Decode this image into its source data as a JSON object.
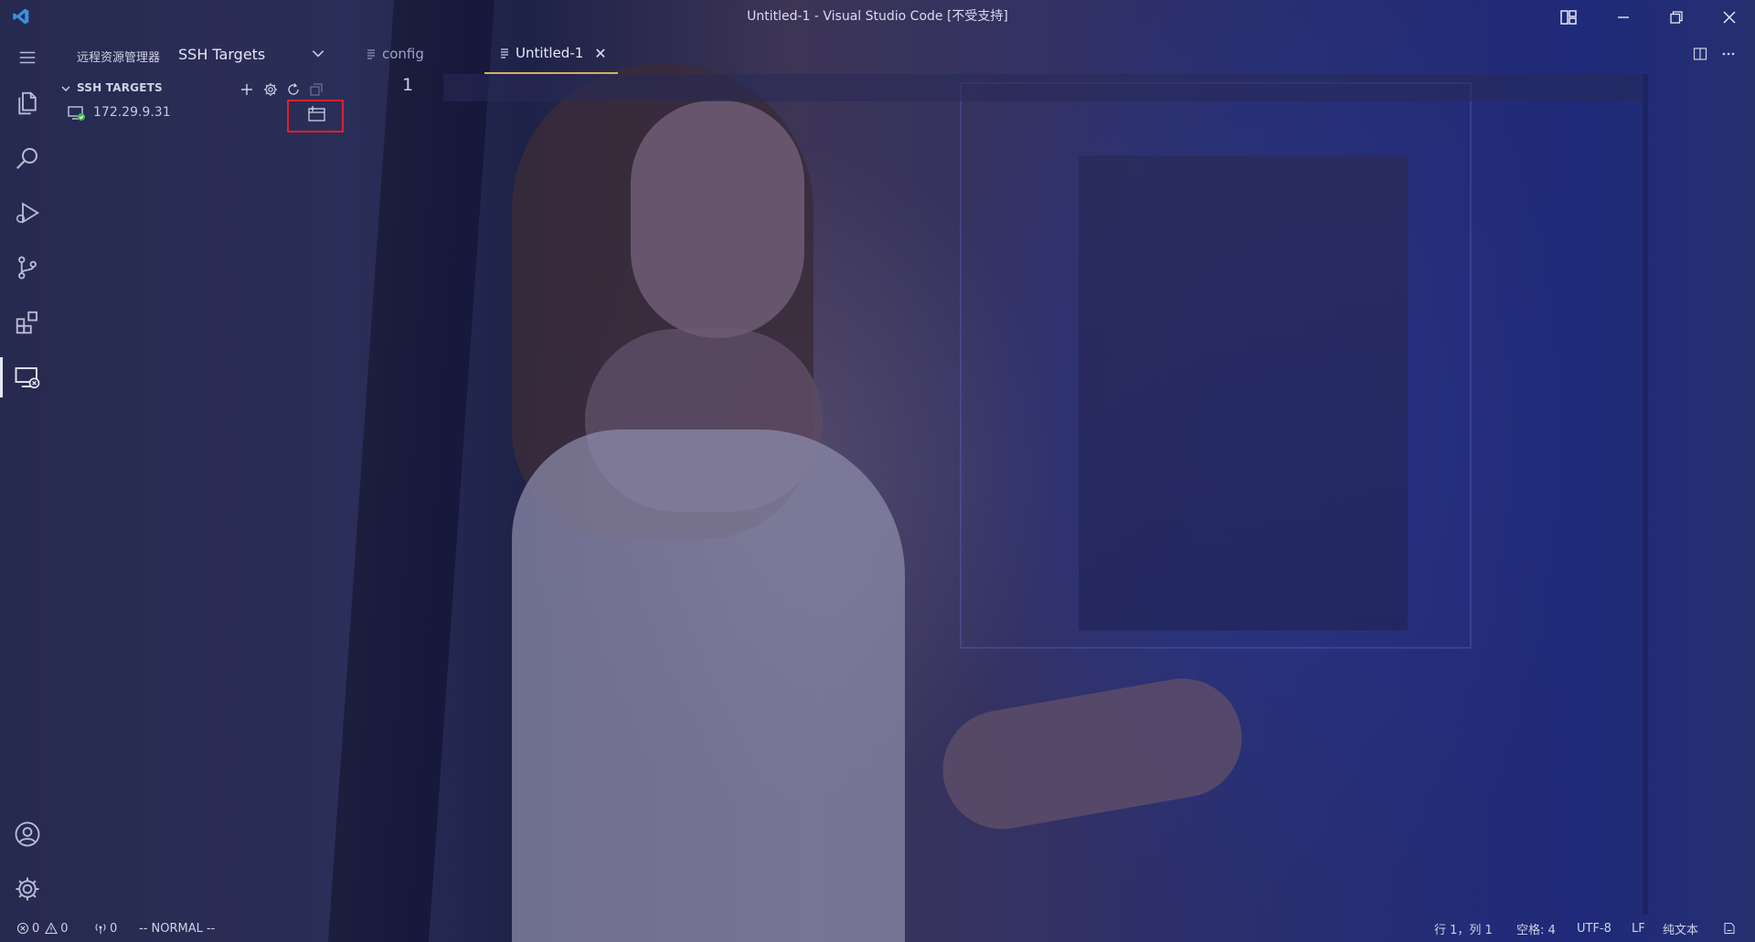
{
  "window": {
    "title": "Untitled-1 - Visual Studio Code [不受支持]",
    "controls": [
      "layout-icon",
      "minimize-icon",
      "restore-icon",
      "close-icon"
    ]
  },
  "activity_bar": {
    "items": [
      "menu-icon",
      "explorer-icon",
      "search-icon",
      "run-debug-icon",
      "source-control-icon",
      "extensions-icon",
      "remote-explorer-icon"
    ],
    "bottom": [
      "accounts-icon",
      "manage-gear-icon"
    ],
    "active": "remote-explorer-icon"
  },
  "sidebar": {
    "header_label": "远程资源管理器",
    "selector_value": "SSH Targets",
    "section_title": "SSH TARGETS",
    "section_actions": [
      "add-icon",
      "settings-gear-icon",
      "refresh-icon",
      "collapse-all-icon"
    ],
    "hosts": [
      {
        "label": "172.29.9.31",
        "action": "open-in-new-window-icon"
      }
    ]
  },
  "editor": {
    "tabs": [
      {
        "label": "config",
        "active": false
      },
      {
        "label": "Untitled-1",
        "active": true,
        "close": "✕"
      }
    ],
    "line_number": "1",
    "actions": [
      "split-editor-icon",
      "more-actions-icon"
    ]
  },
  "status_bar": {
    "errors": "0",
    "warnings": "0",
    "ports": "0",
    "vim_mode": "-- NORMAL --",
    "position": "行 1，列 1",
    "indent": "空格: 4",
    "encoding": "UTF-8",
    "eol": "LF",
    "language": "纯文本"
  },
  "colors": {
    "accent_tab": "#d6b060",
    "highlight_box": "#e0202a",
    "connected_dot": "#3fb950"
  }
}
